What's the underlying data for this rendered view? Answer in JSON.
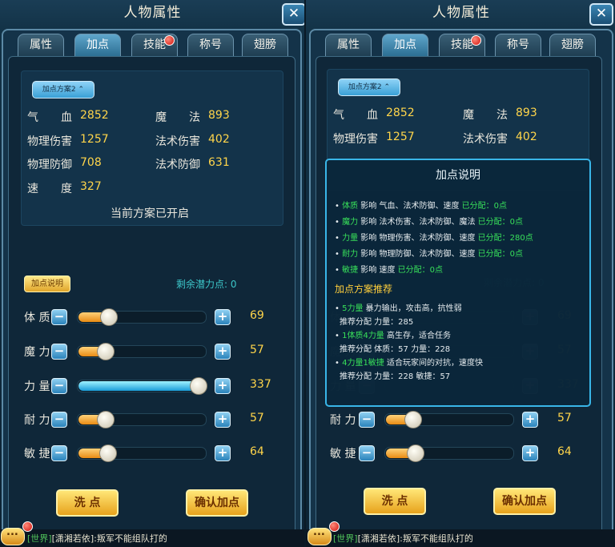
{
  "window_title": "人物属性",
  "tabs": [
    {
      "label": "属性",
      "active": false,
      "badge": false
    },
    {
      "label": "加点",
      "active": true,
      "badge": false
    },
    {
      "label": "技能",
      "active": false,
      "badge": true
    },
    {
      "label": "称号",
      "active": false,
      "badge": false
    },
    {
      "label": "翅膀",
      "active": false,
      "badge": false
    }
  ],
  "plan_button": "加点方案2",
  "stats": [
    {
      "label": "气　　血",
      "value": "2852"
    },
    {
      "label": "魔　　法",
      "value": "893"
    },
    {
      "label": "物理伤害",
      "value": "1257"
    },
    {
      "label": "法术伤害",
      "value": "402"
    },
    {
      "label": "物理防御",
      "value": "708"
    },
    {
      "label": "法术防御",
      "value": "631"
    },
    {
      "label": "速　　度",
      "value": "327"
    }
  ],
  "plan_status": "当前方案已开启",
  "explain_button": "加点说明",
  "remaining_label": "剩余潜力点: 0",
  "left_attrs": [
    {
      "label": "体 质",
      "value": "69",
      "level": 0.2
    },
    {
      "label": "魔 力",
      "value": "57",
      "level": 0.17
    },
    {
      "label": "力 量",
      "value": "337",
      "level": 1.0
    },
    {
      "label": "耐 力",
      "value": "57",
      "level": 0.17
    },
    {
      "label": "敏 捷",
      "value": "64",
      "level": 0.19
    }
  ],
  "right_attrs": [
    {
      "label": "体 质",
      "value": "69"
    },
    {
      "label": "魔 力",
      "value": "57"
    },
    {
      "label": "力 量",
      "value": "337"
    },
    {
      "label": "耐 力",
      "value": "57",
      "level": 0.17
    },
    {
      "label": "敏 捷",
      "value": "64",
      "level": 0.19
    }
  ],
  "wash_button": "洗 点",
  "confirm_button": "确认加点",
  "chat": {
    "channel": "[世界]",
    "sender": "[潇湘若依]:",
    "message": "叛军不能组队打的"
  },
  "tooltip": {
    "title": "加点说明",
    "lines": [
      {
        "attr": "体质",
        "effect": "影响 气血、法术防御、速度",
        "allocated": "已分配：0点"
      },
      {
        "attr": "魔力",
        "effect": "影响 法术伤害、法术防御、魔法",
        "allocated": "已分配：0点"
      },
      {
        "attr": "力量",
        "effect": "影响 物理伤害、法术防御、速度",
        "allocated": "已分配：280点"
      },
      {
        "attr": "耐力",
        "effect": "影响 物理防御、法术防御、速度",
        "allocated": "已分配：0点"
      },
      {
        "attr": "敏捷",
        "effect": "影响 速度",
        "allocated": "已分配：0点"
      }
    ],
    "recommend_title": "加点方案推荐",
    "recommendations": [
      {
        "name": "5力量",
        "desc": "暴力输出，攻击高，抗性弱",
        "detail": "推荐分配 力量：285"
      },
      {
        "name": "1体质4力量",
        "desc": "高生存，适合任务",
        "detail": "推荐分配 体质：57 力量：228"
      },
      {
        "name": "4力量1敏捷",
        "desc": "适合玩家间的对抗，速度快",
        "detail": "推荐分配 力量：228 敏捷：57"
      }
    ]
  },
  "colors": {
    "accent_blue": "#39b6e8",
    "value_yellow": "#ffd54a",
    "green": "#38e05a"
  }
}
